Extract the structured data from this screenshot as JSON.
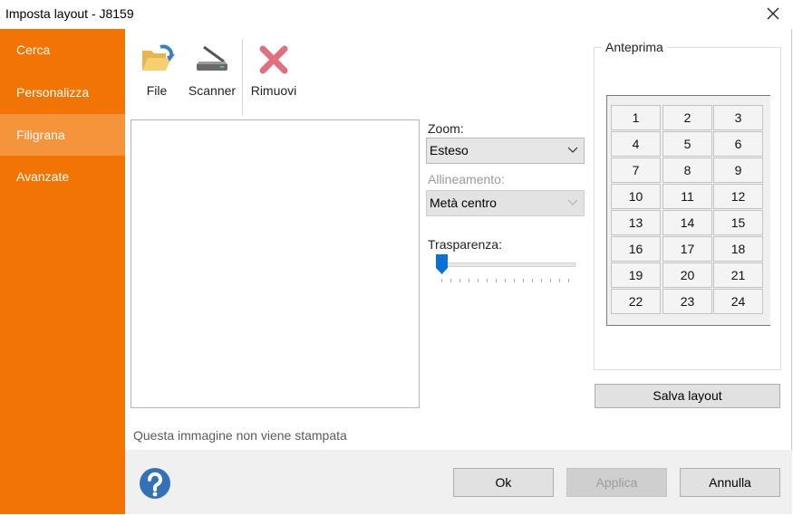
{
  "window": {
    "title": "Imposta layout - J8159",
    "close_icon": "close-icon"
  },
  "sidebar": {
    "items": [
      {
        "label": "Cerca",
        "active": false
      },
      {
        "label": "Personalizza",
        "active": false
      },
      {
        "label": "Filigrana",
        "active": true
      },
      {
        "label": "Avanzate",
        "active": false
      }
    ],
    "accent": "#f27405",
    "active_color": "#f5943a"
  },
  "toolbar": {
    "file": {
      "label": "File",
      "icon": "folder-open-icon"
    },
    "scanner": {
      "label": "Scanner",
      "icon": "scanner-icon"
    },
    "remove": {
      "label": "Rimuovi",
      "icon": "remove-x-icon"
    }
  },
  "image_note": "Questa immagine non viene stampata",
  "zoom": {
    "label": "Zoom:",
    "value": "Esteso"
  },
  "alignment": {
    "label": "Allineamento:",
    "value": "Metà centro",
    "enabled": false
  },
  "transparency": {
    "label": "Trasparenza:",
    "value": 0,
    "min": 0,
    "max": 100
  },
  "preview": {
    "title": "Anteprima",
    "cells": [
      "1",
      "2",
      "3",
      "4",
      "5",
      "6",
      "7",
      "8",
      "9",
      "10",
      "11",
      "12",
      "13",
      "14",
      "15",
      "16",
      "17",
      "18",
      "19",
      "20",
      "21",
      "22",
      "23",
      "24"
    ]
  },
  "buttons": {
    "save_layout": "Salva layout",
    "ok": "Ok",
    "apply": "Applica",
    "cancel": "Annulla"
  },
  "help_icon": "help-icon"
}
